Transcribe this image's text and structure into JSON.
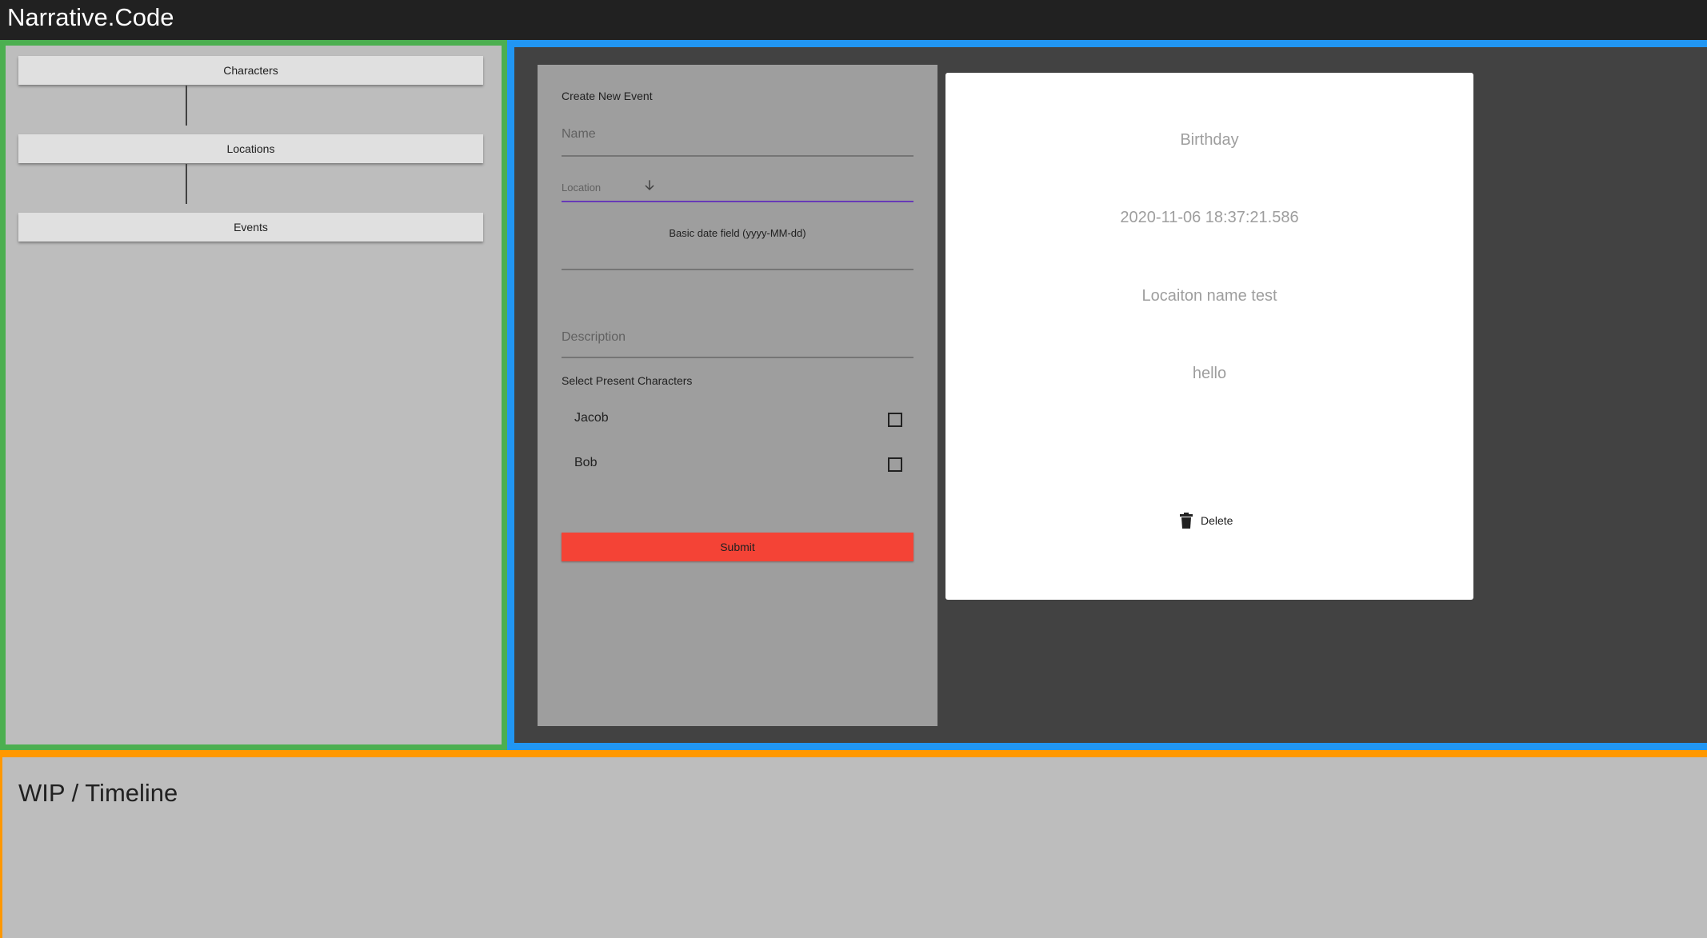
{
  "app": {
    "title": "Narrative.Code"
  },
  "sidebar": {
    "items": [
      {
        "label": "Characters"
      },
      {
        "label": "Locations"
      },
      {
        "label": "Events"
      }
    ]
  },
  "form": {
    "title": "Create New Event",
    "name_label": "Name",
    "location_label": "Location",
    "date_label": "Basic date field (yyyy-MM-dd)",
    "description_label": "Description",
    "characters_label": "Select Present Characters",
    "characters": [
      {
        "name": "Jacob",
        "checked": false
      },
      {
        "name": "Bob",
        "checked": false
      }
    ],
    "submit_label": "Submit"
  },
  "event_card": {
    "name": "Birthday",
    "date": "2020-11-06 18:37:21.586",
    "location": "Locaiton name test",
    "description": "hello",
    "delete_label": "Delete"
  },
  "timeline": {
    "title": "WIP / Timeline"
  },
  "colors": {
    "topbar": "#212121",
    "sidebar_border": "#4caf50",
    "main_border": "#2196f3",
    "timeline_border": "#ff9800",
    "submit": "#f44336",
    "select_underline": "#673ab7"
  },
  "icons": {
    "location_dropdown": "arrow-down-icon",
    "delete": "trash-icon"
  }
}
